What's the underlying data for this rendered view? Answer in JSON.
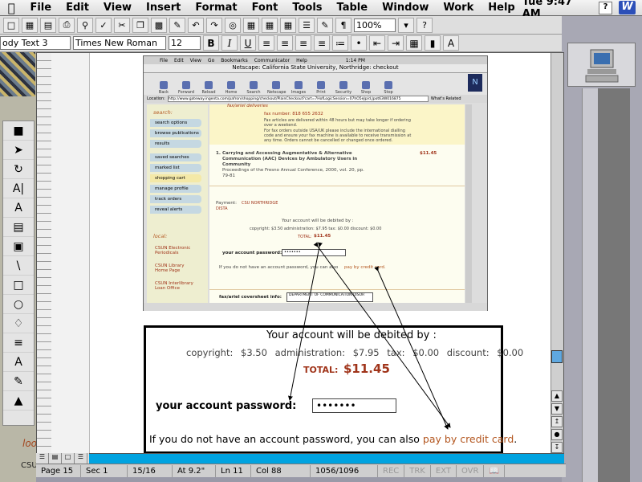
{
  "menubar": {
    "items": [
      "File",
      "Edit",
      "View",
      "Insert",
      "Format",
      "Font",
      "Tools",
      "Table",
      "Window",
      "Work",
      "Help"
    ],
    "clock": "Tue 9:47 AM",
    "app_icon": "W"
  },
  "toolbar2": {
    "style": "ody Text 3",
    "font": "Times New Roman",
    "size": "12",
    "bold": "B",
    "italic": "I",
    "underline": "U"
  },
  "toolbar1": {
    "zoom": "100%"
  },
  "left_text": [
    "loo",
    "CSU"
  ],
  "netscape": {
    "menu": [
      "File",
      "Edit",
      "View",
      "Go",
      "Bookmarks",
      "Communicator",
      "Help"
    ],
    "clock": "1:14 PM",
    "title": "Netscape: California State University, Northridge: checkout",
    "tools": [
      "Back",
      "Forward",
      "Reload",
      "Home",
      "Search",
      "Netscape",
      "Images",
      "Print",
      "Security",
      "Shop",
      "Stop"
    ],
    "location_label": "Location:",
    "url": "http://www.gateway.ingenta.com/pafron/shopping/checkout/PlainCheckout?cart=7HofLogicSession=07hO5eJp/d.Jpot63W016875",
    "whats_related": "What's Related",
    "logo": "N",
    "sidebar": {
      "heading": "search:",
      "items": [
        "search options",
        "browse publications",
        "results",
        "saved searches",
        "marked list",
        "shopping cart",
        "manage profile",
        "track orders",
        "reveal alerts"
      ],
      "local_heading": "local:",
      "local_items": [
        "CSUN Electronic Periodicals",
        "CSUN Library Home Page",
        "CSUN Interlibrary Loan Office"
      ]
    },
    "main": {
      "delivery_heading": "fax/ariel deliveries",
      "fax_number": "fax number: 818 655 2632",
      "fax_lines": [
        "Fax articles are delivered within 48 hours but may take longer if ordering",
        "over a weekend.",
        "For fax orders outside USA/UK please include the international dialling",
        "code and ensure your fax machine is available to receive transmission at",
        "any time. Orders cannot be cancelled or changed once ordered."
      ],
      "item_number": "1.",
      "item_title": [
        "Carrying and Accessing Augmentative & Alternative",
        "Communication (AAC) Devices by Ambulatory Users in",
        "Community"
      ],
      "item_source": [
        "Proceedings of the Fresno Annual Conference, 2000, vol. 20, pp.",
        "79-81"
      ],
      "item_price": "$11.45",
      "payment_label": "Payment:",
      "payment_value": "CSU NORTHRIDGE",
      "payment_value2": "DISTA",
      "debit_heading": "Your account will be debited by :",
      "debit_line": "copyright: $3.50  administration: $7.95  tax: $0.00  discount: $0.00",
      "total_label": "TOTAL:",
      "total_value": "$11.45",
      "password_label": "your account password:",
      "password_value": "•••••••",
      "no_password_text": "If you do not have an account password, you can also",
      "credit_card_link": "pay by credit card.",
      "fax_info_label": "fax/ariel coversheet info:",
      "fax_info_value": "DEPARTMENT OF COMMUNICATION DISOR"
    }
  },
  "zoom": {
    "debit_heading": "Your account will be debited by :",
    "copyright_label": "copyright:",
    "copyright_value": "$3.50",
    "admin_label": "administration:",
    "admin_value": "$7.95",
    "tax_label": "tax:",
    "tax_value": "$0.00",
    "discount_label": "discount:",
    "discount_value": "$0.00",
    "total_label": "TOTAL:",
    "total_value": "$11.45",
    "password_label": "your account password:",
    "password_value": "•••••••",
    "no_password_text": "If you do not have an account password, you can also",
    "credit_card_link": "pay by credit card",
    "period": "."
  },
  "statusbar": {
    "page": "Page 15",
    "sec": "Sec 1",
    "pages": "15/16",
    "at": "At 9.2\"",
    "ln": "Ln 11",
    "col": "Col 88",
    "words": "1056/1096",
    "modes": [
      "REC",
      "TRK",
      "EXT",
      "OVR"
    ]
  },
  "colors": {
    "price": "#a0341a",
    "link": "#b3561f",
    "scroll_accent": "#00a3e0"
  }
}
